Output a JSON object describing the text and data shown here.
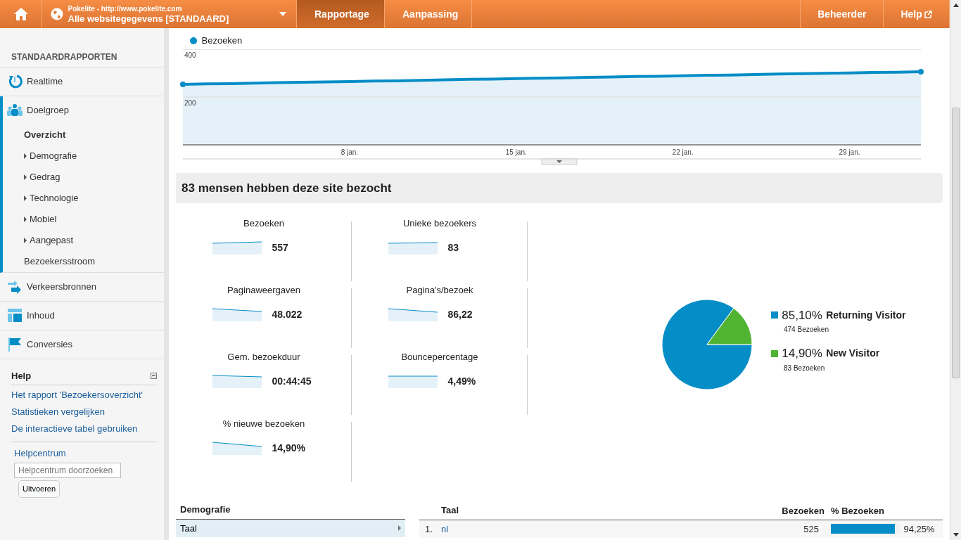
{
  "topbar": {
    "property": {
      "site": "Pokelite - http://www.pokelite.com",
      "view": "Alle websitegegevens [STANDAARD]"
    },
    "tabs": [
      {
        "label": "Rapportage",
        "selected": true
      },
      {
        "label": "Aanpassing",
        "selected": false
      }
    ],
    "right_tabs": [
      {
        "label": "Beheerder"
      },
      {
        "label": "Help"
      }
    ]
  },
  "sidebar": {
    "heading": "STANDAARDRAPPORTEN",
    "sections": [
      {
        "label": "Realtime",
        "expanded": false
      },
      {
        "label": "Doelgroep",
        "expanded": true,
        "children": [
          {
            "label": "Overzicht",
            "kind": "link",
            "selected": true
          },
          {
            "label": "Demografie",
            "kind": "group",
            "selected": false
          },
          {
            "label": "Gedrag",
            "kind": "group",
            "selected": false
          },
          {
            "label": "Technologie",
            "kind": "group",
            "selected": false
          },
          {
            "label": "Mobiel",
            "kind": "group",
            "selected": false
          },
          {
            "label": "Aangepast",
            "kind": "group",
            "selected": false
          },
          {
            "label": "Bezoekersstroom",
            "kind": "link",
            "selected": false
          }
        ]
      },
      {
        "label": "Verkeersbronnen",
        "expanded": false
      },
      {
        "label": "Inhoud",
        "expanded": false
      },
      {
        "label": "Conversies",
        "expanded": false
      }
    ],
    "help": {
      "title": "Help",
      "links": [
        "Het rapport 'Bezoekersoverzicht'",
        "Statistieken vergelijken",
        "De interactieve tabel gebruiken"
      ],
      "center": "Helpcentrum",
      "search": {
        "placeholder": "Helpcentrum doorzoeken"
      },
      "button": "Uitvoeren"
    }
  },
  "chart": {
    "chart_data": {
      "type": "area",
      "categories": [
        null,
        null,
        null,
        null,
        null,
        null,
        null,
        "8 jan.",
        null,
        null,
        null,
        null,
        null,
        null,
        "15 jan.",
        null,
        null,
        null,
        null,
        null,
        null,
        "22 jan.",
        null,
        null,
        null,
        null,
        null,
        null,
        "29 jan.",
        null,
        null,
        null
      ],
      "series": [
        {
          "name": "Bezoeken",
          "color": "#058dc7",
          "values": [
            253,
            255,
            256,
            258,
            260,
            262,
            263,
            265,
            267,
            268,
            270,
            272,
            274,
            275,
            277,
            279,
            280,
            282,
            284,
            286,
            287,
            289,
            291,
            292,
            294,
            296,
            298,
            299,
            301,
            303,
            304,
            306
          ]
        }
      ],
      "ylim": [
        0,
        400
      ],
      "yticks": [
        200,
        400
      ]
    }
  },
  "summary": {
    "title": "83 mensen hebben deze site bezocht",
    "metrics": [
      {
        "label": "Bezoeken",
        "value": "557"
      },
      {
        "label": "Unieke bezoekers",
        "value": "83"
      },
      {
        "label": "Paginaweergaven",
        "value": "48.022"
      },
      {
        "label": "Pagina's/bezoek",
        "value": "86,22"
      },
      {
        "label": "Gem. bezoekduur",
        "value": "00:44:45"
      },
      {
        "label": "Bouncepercentage",
        "value": "4,49%"
      },
      {
        "label": "% nieuwe bezoeken",
        "value": "14,90%"
      }
    ],
    "pie": {
      "chart_data": {
        "type": "pie",
        "categories": [
          "Returning Visitor",
          "New Visitor"
        ],
        "values": [
          85.1,
          14.9
        ],
        "colors": [
          "#058dc7",
          "#50b432"
        ]
      },
      "legend": [
        {
          "percent": "85,10%",
          "sub": "474 Bezoeken"
        },
        {
          "percent": "14,90%",
          "sub": "83 Bezoeken"
        }
      ]
    }
  },
  "demographics": {
    "heading": "Demografie",
    "items": [
      {
        "label": "Taal",
        "selected": true
      }
    ],
    "table": {
      "columns": [
        "Taal",
        "Bezoeken",
        "% Bezoeken"
      ],
      "rows": [
        {
          "rank": "1.",
          "name": "nl",
          "visits": "525",
          "percent": "94,25%",
          "level": 0.9425
        }
      ]
    }
  }
}
